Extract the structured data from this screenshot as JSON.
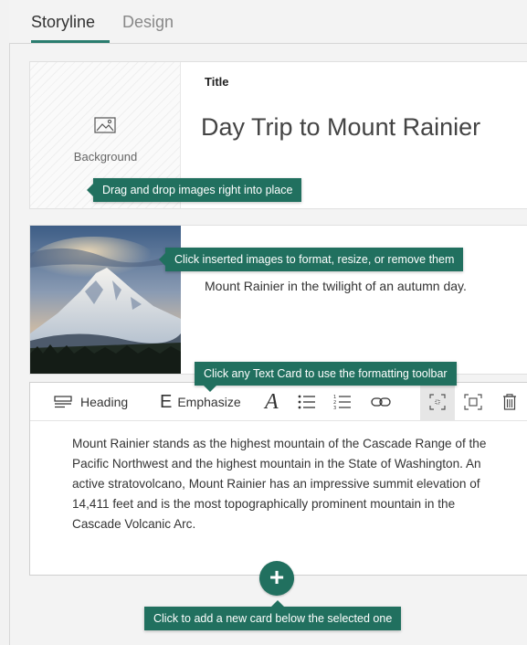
{
  "tabs": [
    {
      "label": "Storyline",
      "active": true
    },
    {
      "label": "Design",
      "active": false
    }
  ],
  "title_card": {
    "background_label": "Background",
    "title_label": "Title",
    "title_text": "Day Trip to Mount Rainier"
  },
  "image_card": {
    "caption": "Mount Rainier in the twilight of an autumn day."
  },
  "text_card": {
    "toolbar": {
      "heading_label": "Heading",
      "emphasize_label": "Emphasize",
      "emphasize_glyph": "E",
      "accent_glyph": "A"
    },
    "body": "Mount Rainier stands as the highest mountain of the Cascade Range of the Pacific Northwest and the highest mountain in the State of Washington. An active stratovolcano, Mount Rainier has an impressive summit elevation of 14,411 feet and is the most topographically prominent mountain in the Cascade Volcanic Arc."
  },
  "add_button": {
    "glyph": "+"
  },
  "tooltips": {
    "drag": "Drag and drop images right into place",
    "image": "Click inserted images to format, resize, or remove them",
    "text": "Click any Text Card to use the formatting toolbar",
    "add": "Click to add a new card below the selected one"
  },
  "colors": {
    "accent": "#21705f",
    "tab_underline": "#2a7d6f"
  }
}
